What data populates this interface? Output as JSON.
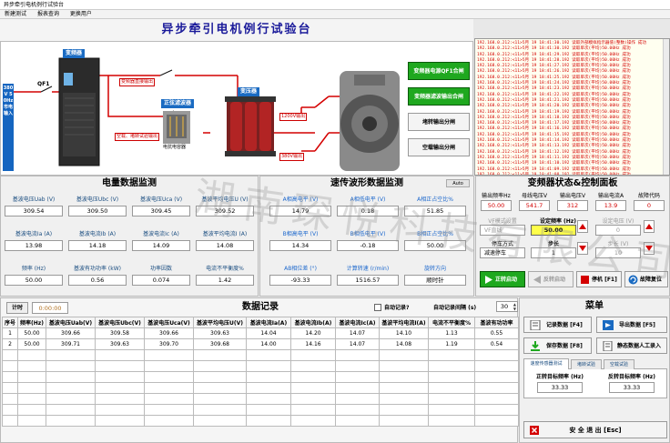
{
  "window": {
    "title": "异步牵引电机例行试验台"
  },
  "menu": [
    "新建测试",
    "报表查询",
    "更换用户"
  ],
  "banner": "异步牵引电机例行试验台",
  "schematic": {
    "supply": "380V 50Hz 市电输入",
    "qf1": "QF1",
    "converter": "变频器",
    "sine_filter": "正弦滤波器",
    "sine_filter_note": "电抗电容器",
    "transformer": "变压器",
    "bypass_note": "变频器直接输出",
    "filter_note": "空载、堵转试验输出",
    "out_1200": "1200V输出",
    "out_380": "380V输出",
    "buttons": [
      "变频器电源QF1合闸",
      "变频器滤波输出合闸",
      "堵转输出分闸",
      "空载输出分闸"
    ]
  },
  "log": {
    "lines": [
      "192.168.0.212:<11>5月 19 18:41:30.192 读取外部模拟指示器值(整数)操作 成功",
      "192.168.0.212:<11>5月 19 18:41:30.192 读取单次(平均)50.00Hz 成功",
      "192.168.0.212:<11>5月 19 18:41:29.192 读取单次(平均)50.00Hz 成功",
      "192.168.0.212:<11>5月 19 18:41:28.192 读取单次(平均)50.00Hz 成功",
      "192.168.0.212:<11>5月 19 18:41:27.192 读取单次(平均)50.00Hz 成功",
      "192.168.0.212:<11>5月 19 18:41:26.192 读取单次(平均)50.00Hz 成功",
      "192.168.0.212:<11>5月 19 18:41:25.192 读取单次(平均)50.00Hz 成功",
      "192.168.0.212:<11>5月 19 18:41:24.192 读取单次(平均)50.00Hz 成功",
      "192.168.0.212:<11>5月 19 18:41:23.192 读取单次(平均)50.00Hz 成功",
      "192.168.0.212:<11>5月 19 18:41:22.192 读取单次(平均)50.00Hz 成功",
      "192.168.0.212:<11>5月 19 18:41:21.192 读取单次(平均)50.00Hz 成功",
      "192.168.0.212:<11>5月 19 18:41:20.192 读取单次(平均)50.00Hz 成功",
      "192.168.0.212:<11>5月 19 18:41:19.192 读取单次(平均)50.00Hz 成功",
      "192.168.0.212:<11>5月 19 18:41:18.192 读取单次(平均)50.00Hz 成功",
      "192.168.0.212:<11>5月 19 18:41:17.192 读取单次(平均)50.00Hz 成功",
      "192.168.0.212:<11>5月 19 18:41:16.192 读取单次(平均)50.00Hz 成功",
      "192.168.0.212:<11>5月 19 18:41:15.192 读取单次(平均)50.00Hz 成功",
      "192.168.0.212:<11>5月 19 18:41:14.192 读取单次(平均)50.00Hz 成功",
      "192.168.0.212:<11>5月 19 18:41:13.192 读取单次(平均)50.00Hz 成功",
      "192.168.0.212:<11>5月 19 18:41:12.192 读取单次(平均)50.00Hz 成功",
      "192.168.0.212:<11>5月 19 18:41:11.192 读取单次(平均)50.00Hz 成功",
      "192.168.0.212:<11>5月 19 18:41:10.192 读取单次(平均)50.00Hz 成功",
      "192.168.0.212:<11>5月 19 18:41:09.192 读取单次(平均)50.00Hz 成功",
      "192.168.0.212:<11>5月 19 18:41:08.192 读取单次(平均)50.00Hz 成功"
    ]
  },
  "elec": {
    "title": "电量数据监测",
    "items": [
      {
        "label": "基波电压Uab (V)",
        "value": "309.54"
      },
      {
        "label": "基波电压Ubc (V)",
        "value": "309.50"
      },
      {
        "label": "基波电压Uca (V)",
        "value": "309.45"
      },
      {
        "label": "基波平均电压U (V)",
        "value": "309.52"
      },
      {
        "label": "基波电流Ia (A)",
        "value": "13.98"
      },
      {
        "label": "基波电流Ib (A)",
        "value": "14.18"
      },
      {
        "label": "基波电流Ic (A)",
        "value": "14.09"
      },
      {
        "label": "基波平均电流I (A)",
        "value": "14.08"
      },
      {
        "label": "频率 (Hz)",
        "value": "50.00"
      },
      {
        "label": "基波有功功率 (kW)",
        "value": "0.56"
      },
      {
        "label": "功率因数",
        "value": "0.074"
      },
      {
        "label": "电流不平衡度%",
        "value": "1.42"
      }
    ]
  },
  "speed": {
    "title": "速传波形数据监测",
    "auto": "Auto",
    "items": [
      {
        "label": "A相高电平 (V)",
        "value": "14.79"
      },
      {
        "label": "A相低电平 (V)",
        "value": "0.18"
      },
      {
        "label": "A相正占空比%",
        "value": "51.85"
      },
      {
        "label": "B相高电平 (V)",
        "value": "14.34"
      },
      {
        "label": "B相低电平 (V)",
        "value": "-0.18"
      },
      {
        "label": "B相正占空比%",
        "value": "50.00"
      },
      {
        "label": "AB相位差 (°)",
        "value": "-93.33"
      },
      {
        "label": "计算转速 (r/min)",
        "value": "1516.57"
      },
      {
        "label": "旋转方向",
        "value": "顺时针"
      }
    ]
  },
  "vfd": {
    "title": "变频器状态&控制面板",
    "status": [
      {
        "label": "输出频率Hz",
        "value": "50.00"
      },
      {
        "label": "母线电压V",
        "value": "541.7"
      },
      {
        "label": "输出电压V",
        "value": "312"
      },
      {
        "label": "输出电流A",
        "value": "13.9"
      },
      {
        "label": "故障代码",
        "value": "0"
      }
    ],
    "mode_label": "VF模式设置",
    "mode_value": "VF直线",
    "set_freq_label": "设定频率 (Hz)",
    "set_freq_value": "50.00",
    "set_volt_label": "设定电压 (V)",
    "set_volt_value": "0",
    "stop_label": "停车方式",
    "stop_value": "减速停车",
    "step_label": "步长",
    "step_value": "1",
    "step2_label": "步长 (V)",
    "step2_value": "10",
    "buttons": {
      "fwd": "正转启动",
      "rev": "反转启动",
      "stop": "停机 [F1]",
      "reset": "故障复位"
    }
  },
  "records": {
    "timer_btn": "计时",
    "timer_value": "0:00:00",
    "title": "数据记录",
    "auto_label": "自动记录?",
    "interval_label": "自动记录间隔 (s)",
    "interval_value": "30",
    "columns": [
      "序号",
      "频率(Hz)",
      "基波电压Uab(V)",
      "基波电压Ubc(V)",
      "基波电压Uca(V)",
      "基波平均电压U(V)",
      "基波电流Ia(A)",
      "基波电流Ib(A)",
      "基波电流Ic(A)",
      "基波平均电流I(A)",
      "电流不平衡度%",
      "基波有功功率"
    ],
    "rows": [
      [
        "1",
        "50.00",
        "309.66",
        "309.58",
        "309.66",
        "309.63",
        "14.04",
        "14.20",
        "14.07",
        "14.10",
        "1.13",
        "0.55"
      ],
      [
        "2",
        "50.00",
        "309.71",
        "309.63",
        "309.70",
        "309.68",
        "14.00",
        "14.16",
        "14.07",
        "14.08",
        "1.19",
        "0.54"
      ]
    ]
  },
  "menu_panel": {
    "title": "菜单",
    "btn_record": "记录数据 [F4]",
    "btn_export": "导出数据 [F5]",
    "btn_save": "保存数据 [F8]",
    "btn_static": "静态数据人工录入",
    "tabs": [
      "速度传感器测试",
      "堵转试验",
      "空载试验"
    ],
    "fwd_freq_label": "正转目标频率 (Hz)",
    "fwd_freq_value": "33.33",
    "rev_freq_label": "反转目标频率 (Hz)",
    "rev_freq_value": "33.33",
    "exit": "安 全 退 出 [Esc]"
  },
  "watermark": "湖南琛悦科技有限公司"
}
